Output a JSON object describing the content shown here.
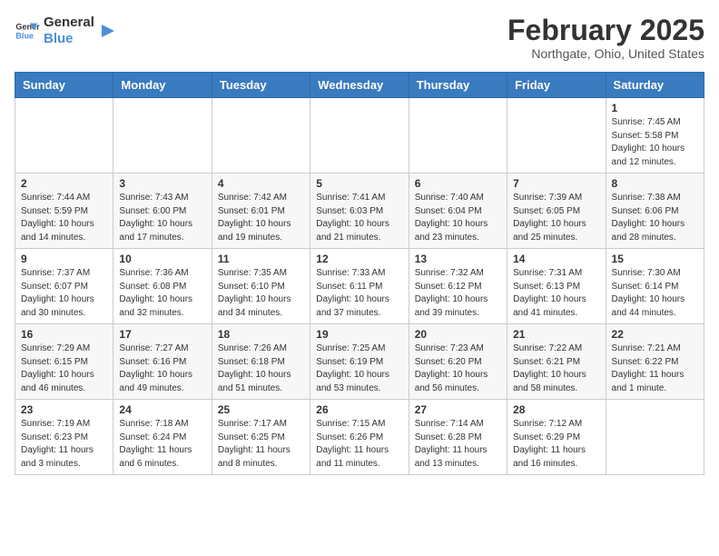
{
  "header": {
    "logo_line1": "General",
    "logo_line2": "Blue",
    "month_title": "February 2025",
    "location": "Northgate, Ohio, United States"
  },
  "weekdays": [
    "Sunday",
    "Monday",
    "Tuesday",
    "Wednesday",
    "Thursday",
    "Friday",
    "Saturday"
  ],
  "weeks": [
    [
      {
        "day": "",
        "info": ""
      },
      {
        "day": "",
        "info": ""
      },
      {
        "day": "",
        "info": ""
      },
      {
        "day": "",
        "info": ""
      },
      {
        "day": "",
        "info": ""
      },
      {
        "day": "",
        "info": ""
      },
      {
        "day": "1",
        "info": "Sunrise: 7:45 AM\nSunset: 5:58 PM\nDaylight: 10 hours\nand 12 minutes."
      }
    ],
    [
      {
        "day": "2",
        "info": "Sunrise: 7:44 AM\nSunset: 5:59 PM\nDaylight: 10 hours\nand 14 minutes."
      },
      {
        "day": "3",
        "info": "Sunrise: 7:43 AM\nSunset: 6:00 PM\nDaylight: 10 hours\nand 17 minutes."
      },
      {
        "day": "4",
        "info": "Sunrise: 7:42 AM\nSunset: 6:01 PM\nDaylight: 10 hours\nand 19 minutes."
      },
      {
        "day": "5",
        "info": "Sunrise: 7:41 AM\nSunset: 6:03 PM\nDaylight: 10 hours\nand 21 minutes."
      },
      {
        "day": "6",
        "info": "Sunrise: 7:40 AM\nSunset: 6:04 PM\nDaylight: 10 hours\nand 23 minutes."
      },
      {
        "day": "7",
        "info": "Sunrise: 7:39 AM\nSunset: 6:05 PM\nDaylight: 10 hours\nand 25 minutes."
      },
      {
        "day": "8",
        "info": "Sunrise: 7:38 AM\nSunset: 6:06 PM\nDaylight: 10 hours\nand 28 minutes."
      }
    ],
    [
      {
        "day": "9",
        "info": "Sunrise: 7:37 AM\nSunset: 6:07 PM\nDaylight: 10 hours\nand 30 minutes."
      },
      {
        "day": "10",
        "info": "Sunrise: 7:36 AM\nSunset: 6:08 PM\nDaylight: 10 hours\nand 32 minutes."
      },
      {
        "day": "11",
        "info": "Sunrise: 7:35 AM\nSunset: 6:10 PM\nDaylight: 10 hours\nand 34 minutes."
      },
      {
        "day": "12",
        "info": "Sunrise: 7:33 AM\nSunset: 6:11 PM\nDaylight: 10 hours\nand 37 minutes."
      },
      {
        "day": "13",
        "info": "Sunrise: 7:32 AM\nSunset: 6:12 PM\nDaylight: 10 hours\nand 39 minutes."
      },
      {
        "day": "14",
        "info": "Sunrise: 7:31 AM\nSunset: 6:13 PM\nDaylight: 10 hours\nand 41 minutes."
      },
      {
        "day": "15",
        "info": "Sunrise: 7:30 AM\nSunset: 6:14 PM\nDaylight: 10 hours\nand 44 minutes."
      }
    ],
    [
      {
        "day": "16",
        "info": "Sunrise: 7:29 AM\nSunset: 6:15 PM\nDaylight: 10 hours\nand 46 minutes."
      },
      {
        "day": "17",
        "info": "Sunrise: 7:27 AM\nSunset: 6:16 PM\nDaylight: 10 hours\nand 49 minutes."
      },
      {
        "day": "18",
        "info": "Sunrise: 7:26 AM\nSunset: 6:18 PM\nDaylight: 10 hours\nand 51 minutes."
      },
      {
        "day": "19",
        "info": "Sunrise: 7:25 AM\nSunset: 6:19 PM\nDaylight: 10 hours\nand 53 minutes."
      },
      {
        "day": "20",
        "info": "Sunrise: 7:23 AM\nSunset: 6:20 PM\nDaylight: 10 hours\nand 56 minutes."
      },
      {
        "day": "21",
        "info": "Sunrise: 7:22 AM\nSunset: 6:21 PM\nDaylight: 10 hours\nand 58 minutes."
      },
      {
        "day": "22",
        "info": "Sunrise: 7:21 AM\nSunset: 6:22 PM\nDaylight: 11 hours\nand 1 minute."
      }
    ],
    [
      {
        "day": "23",
        "info": "Sunrise: 7:19 AM\nSunset: 6:23 PM\nDaylight: 11 hours\nand 3 minutes."
      },
      {
        "day": "24",
        "info": "Sunrise: 7:18 AM\nSunset: 6:24 PM\nDaylight: 11 hours\nand 6 minutes."
      },
      {
        "day": "25",
        "info": "Sunrise: 7:17 AM\nSunset: 6:25 PM\nDaylight: 11 hours\nand 8 minutes."
      },
      {
        "day": "26",
        "info": "Sunrise: 7:15 AM\nSunset: 6:26 PM\nDaylight: 11 hours\nand 11 minutes."
      },
      {
        "day": "27",
        "info": "Sunrise: 7:14 AM\nSunset: 6:28 PM\nDaylight: 11 hours\nand 13 minutes."
      },
      {
        "day": "28",
        "info": "Sunrise: 7:12 AM\nSunset: 6:29 PM\nDaylight: 11 hours\nand 16 minutes."
      },
      {
        "day": "",
        "info": ""
      }
    ]
  ]
}
